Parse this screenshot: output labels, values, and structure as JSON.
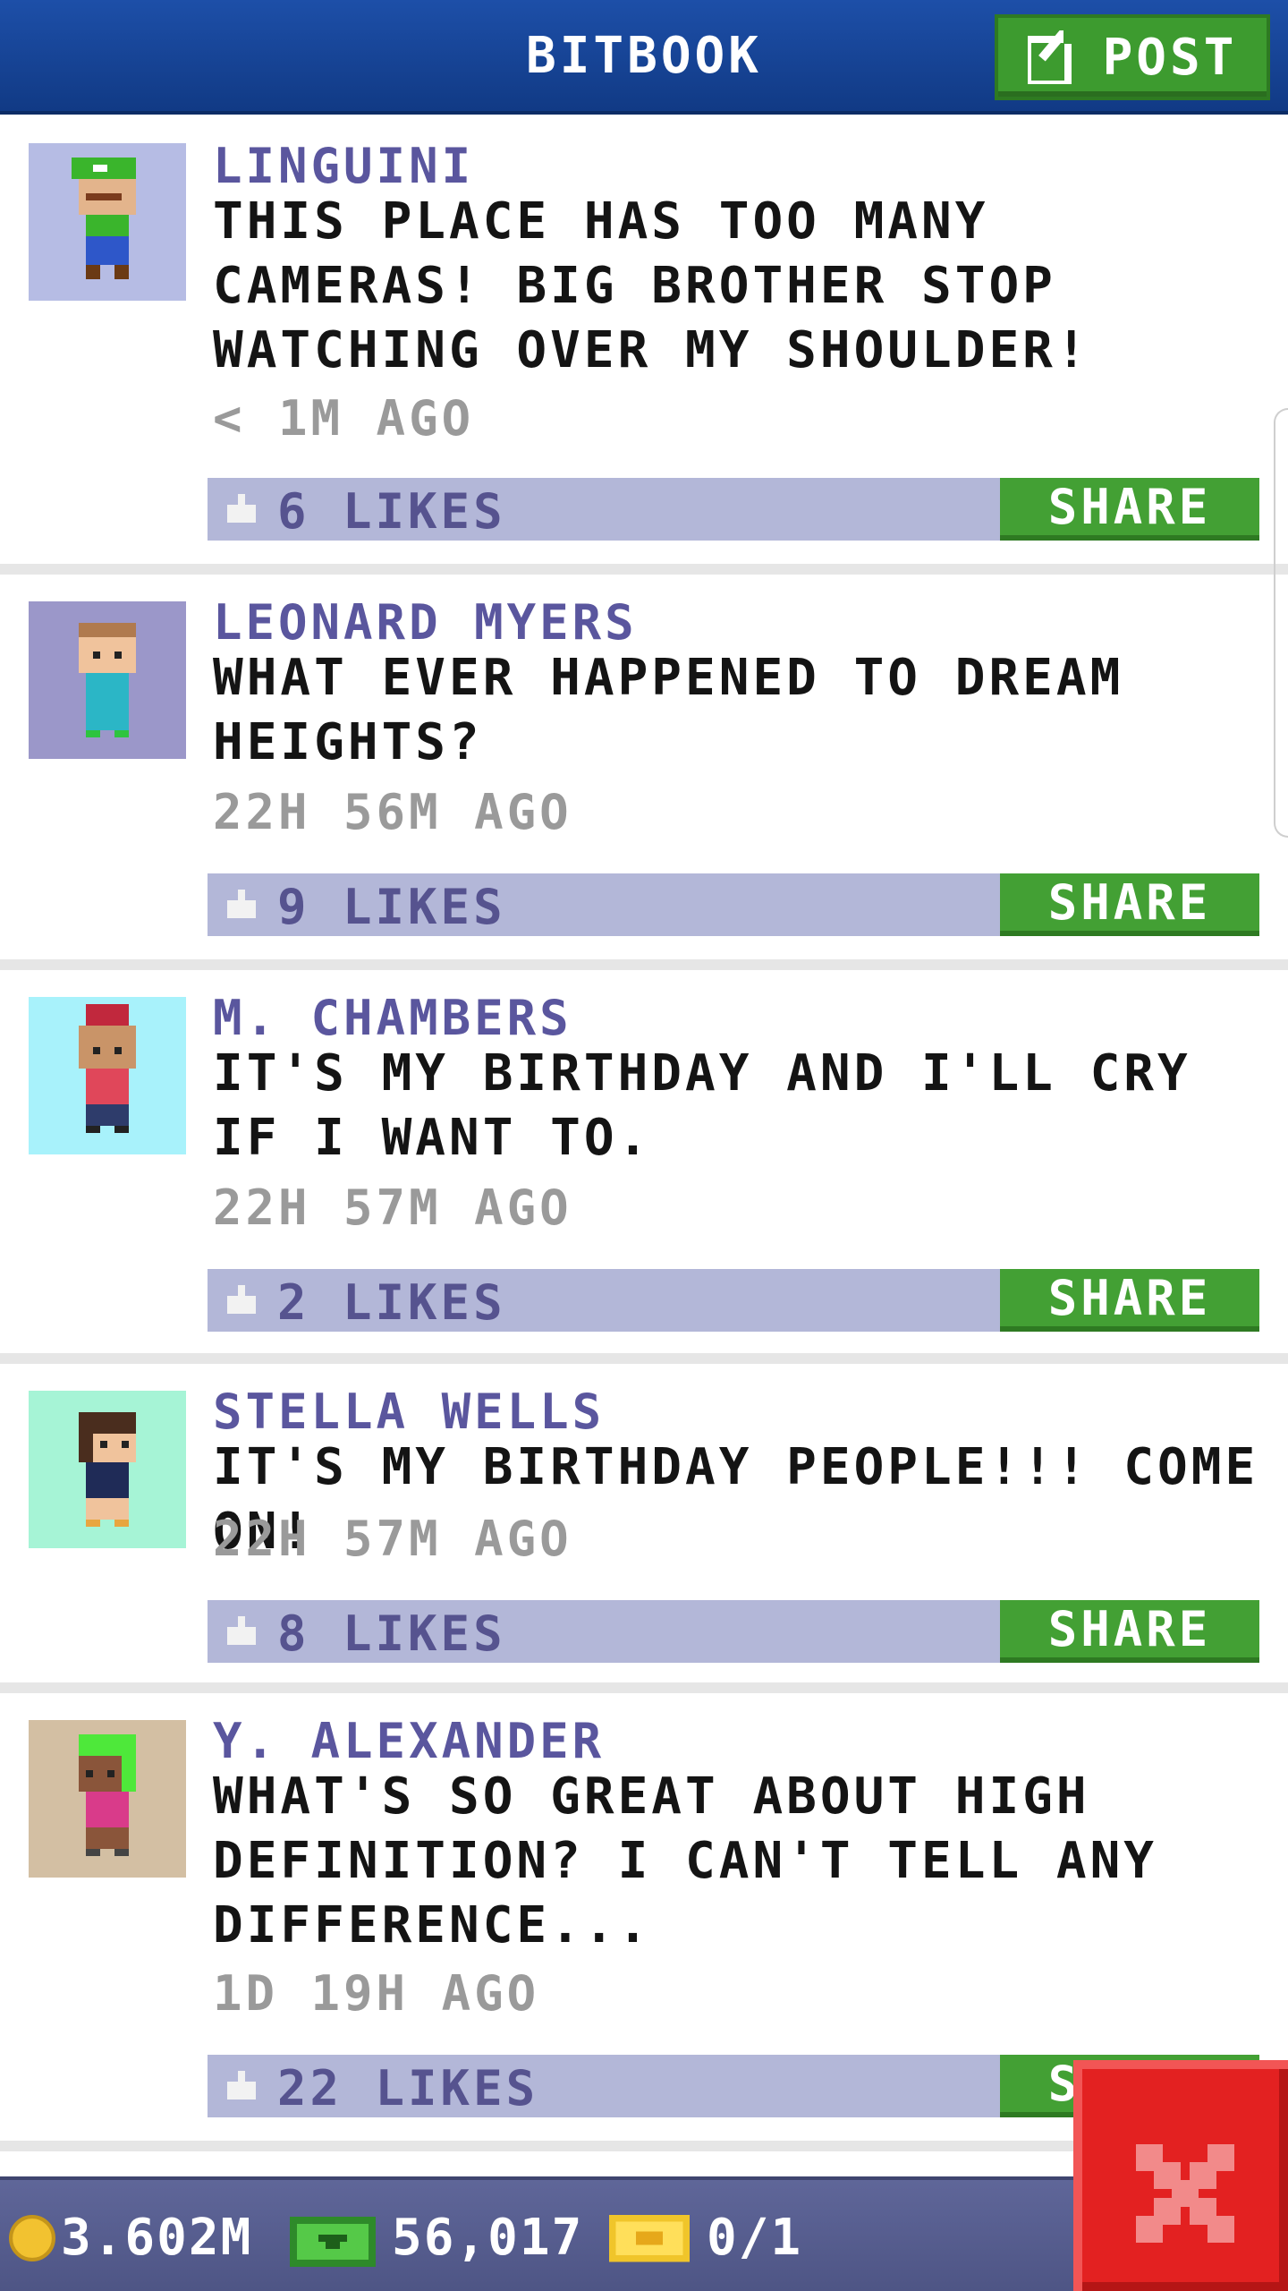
{
  "header": {
    "title": "BITBOOK",
    "post_label": "POST"
  },
  "posts": [
    {
      "author": "LINGUINI",
      "text": "THIS PLACE HAS TOO MANY CAMERAS! BIG BROTHER STOP WATCHING OVER MY SHOULDER!",
      "time": "< 1M AGO",
      "likes": "6 LIKES",
      "share_label": "SHARE",
      "avatar_bg": "#b6bce4"
    },
    {
      "author": "LEONARD MYERS",
      "text": "WHAT EVER HAPPENED TO DREAM HEIGHTS?",
      "time": "22H 56M AGO",
      "likes": "9 LIKES",
      "share_label": "SHARE",
      "avatar_bg": "#9b97c9"
    },
    {
      "author": "M. CHAMBERS",
      "text": "IT'S MY BIRTHDAY AND I'LL CRY IF I WANT TO.",
      "time": "22H 57M AGO",
      "likes": "2 LIKES",
      "share_label": "SHARE",
      "avatar_bg": "#a8f2fb"
    },
    {
      "author": "STELLA WELLS",
      "text": "IT'S MY BIRTHDAY PEOPLE!!! COME ON!",
      "time": "22H 57M AGO",
      "likes": "8 LIKES",
      "share_label": "SHARE",
      "avatar_bg": "#a6f4d6"
    },
    {
      "author": "Y. ALEXANDER",
      "text": "WHAT'S SO GREAT ABOUT HIGH DEFINITION? I CAN'T TELL ANY DIFFERENCE...",
      "time": "1D 19H AGO",
      "likes": "22 LIKES",
      "share_label": "SHARE",
      "avatar_bg": "#d3bfa3"
    }
  ],
  "status": {
    "coins": "3.602M",
    "bux": "56,017",
    "tickets": "0/1"
  },
  "icons": {
    "post": "edit-icon",
    "like": "thumbs-up-icon",
    "coin": "coin-icon",
    "bux": "bux-icon",
    "ticket": "ticket-icon",
    "close": "close-icon"
  },
  "colors": {
    "header": "#1d4fa8",
    "share": "#43a034",
    "likes_bar": "#b3b7d8",
    "close": "#e32121"
  }
}
